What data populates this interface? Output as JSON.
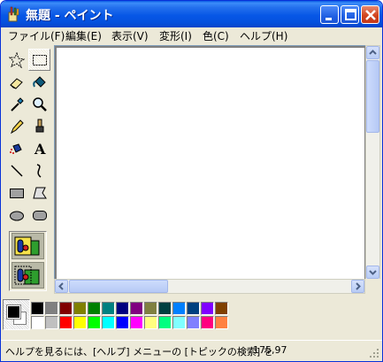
{
  "window": {
    "title": "無題 - ペイント",
    "title_icon": "paint-app-icon"
  },
  "title_buttons": [
    "minimize-icon",
    "maximize-icon",
    "close-icon"
  ],
  "menu": {
    "file": "ファイル(F)",
    "edit": "編集(E)",
    "view": "表示(V)",
    "image": "変形(I)",
    "colors": "色(C)",
    "help": "ヘルプ(H)"
  },
  "tools": [
    {
      "name": "free-form-select-icon",
      "active": false
    },
    {
      "name": "rectangle-select-icon",
      "active": true
    },
    {
      "name": "eraser-icon",
      "active": false
    },
    {
      "name": "fill-bucket-icon",
      "active": false
    },
    {
      "name": "pick-color-icon",
      "active": false
    },
    {
      "name": "magnifier-icon",
      "active": false
    },
    {
      "name": "pencil-icon",
      "active": false
    },
    {
      "name": "brush-icon",
      "active": false
    },
    {
      "name": "airbrush-icon",
      "active": false
    },
    {
      "name": "text-icon",
      "active": false
    },
    {
      "name": "line-icon",
      "active": false
    },
    {
      "name": "curve-icon",
      "active": false
    },
    {
      "name": "rectangle-icon",
      "active": false
    },
    {
      "name": "polygon-icon",
      "active": false
    },
    {
      "name": "ellipse-icon",
      "active": false
    },
    {
      "name": "rounded-rectangle-icon",
      "active": false
    }
  ],
  "tool_options": [
    "opaque-selection-icon",
    "transparent-selection-icon"
  ],
  "colors": {
    "foreground": "#000000",
    "background": "#ffffff",
    "palette_top": [
      "#000000",
      "#808080",
      "#800000",
      "#808000",
      "#008000",
      "#008080",
      "#000080",
      "#800080",
      "#808040",
      "#004040",
      "#0080ff",
      "#004080",
      "#8000ff",
      "#804000"
    ],
    "palette_bottom": [
      "#ffffff",
      "#c0c0c0",
      "#ff0000",
      "#ffff00",
      "#00ff00",
      "#00ffff",
      "#0000ff",
      "#ff00ff",
      "#ffff80",
      "#00ff80",
      "#80ffff",
      "#8080ff",
      "#ff0080",
      "#ff8040"
    ]
  },
  "status": {
    "hint": "ヘルプを見るには、[ヘルプ] メニューの [トピックの検索] を",
    "coords": "175,97"
  }
}
